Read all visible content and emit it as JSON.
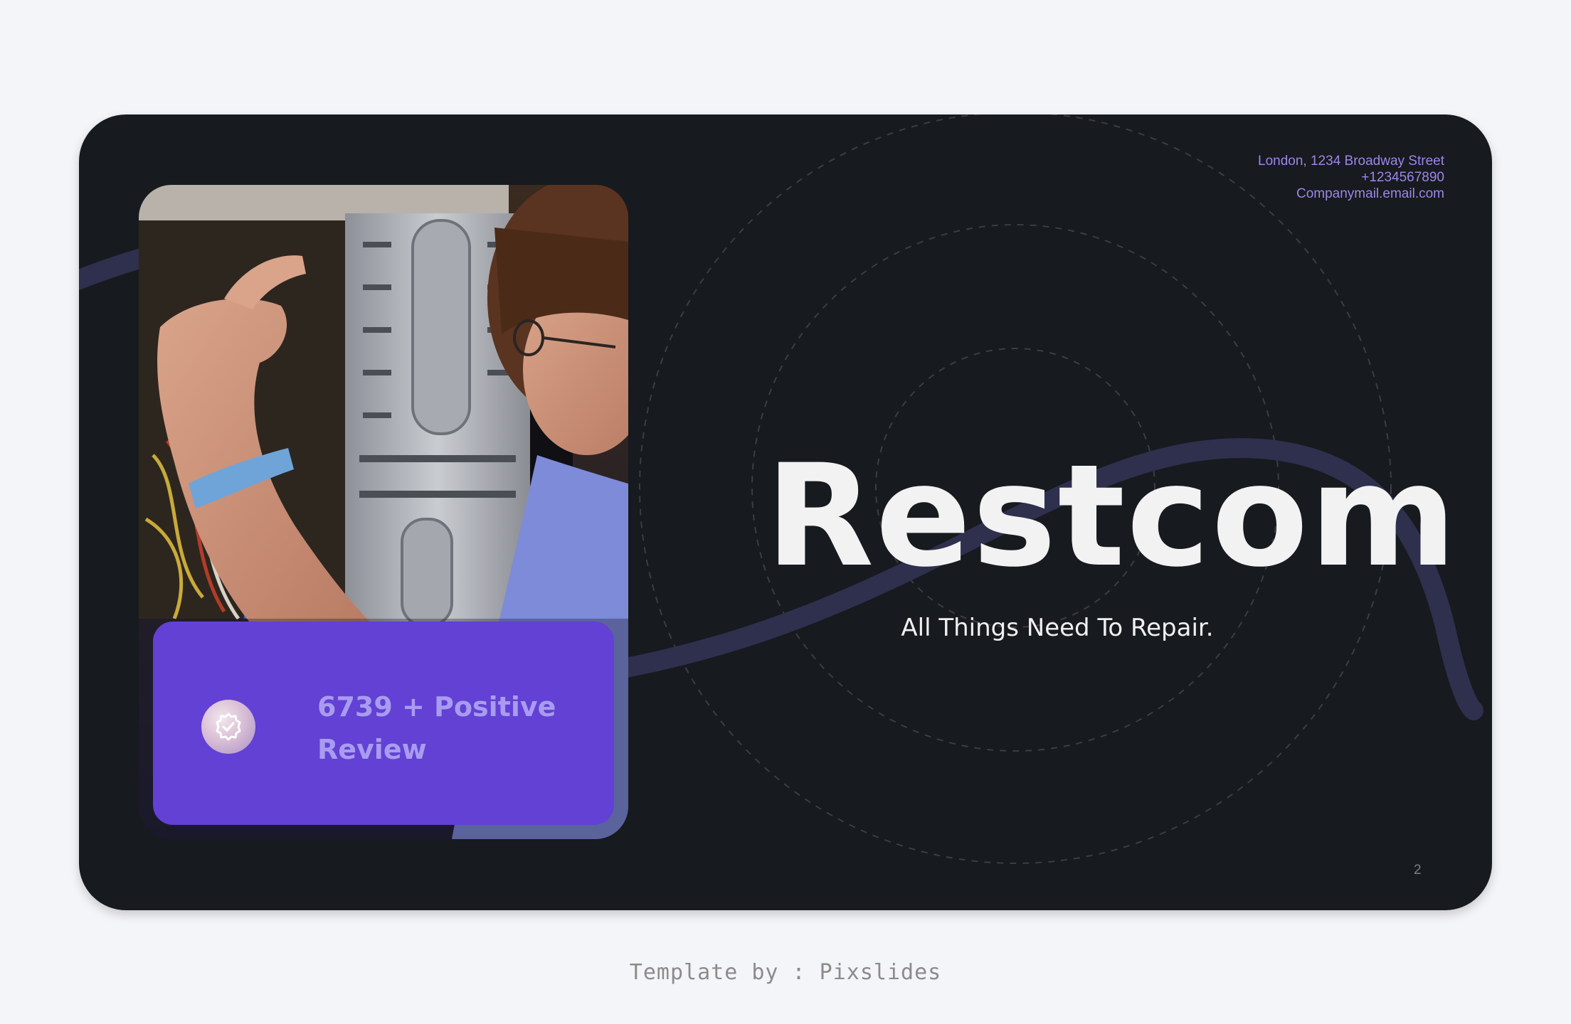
{
  "contact": {
    "address": "London, 1234 Broadway Street",
    "phone": "+1234567890",
    "email": "Companymail.email.com"
  },
  "hero": {
    "title": "Restcom",
    "tagline": "All Things Need To Repair."
  },
  "review_card": {
    "badge_icon": "verified-check-icon",
    "text": "6739 + Positive Review"
  },
  "photo": {
    "icon": "technician-repairing-computer-photo"
  },
  "page_number": "2",
  "footer": {
    "credit": "Template by : Pixslides"
  },
  "colors": {
    "page_background": "#f4f5f9",
    "slide_background": "#171a1e",
    "accent_purple": "#6241d4",
    "contact_text": "#9c86ea",
    "wave": "#2f2f4e"
  }
}
